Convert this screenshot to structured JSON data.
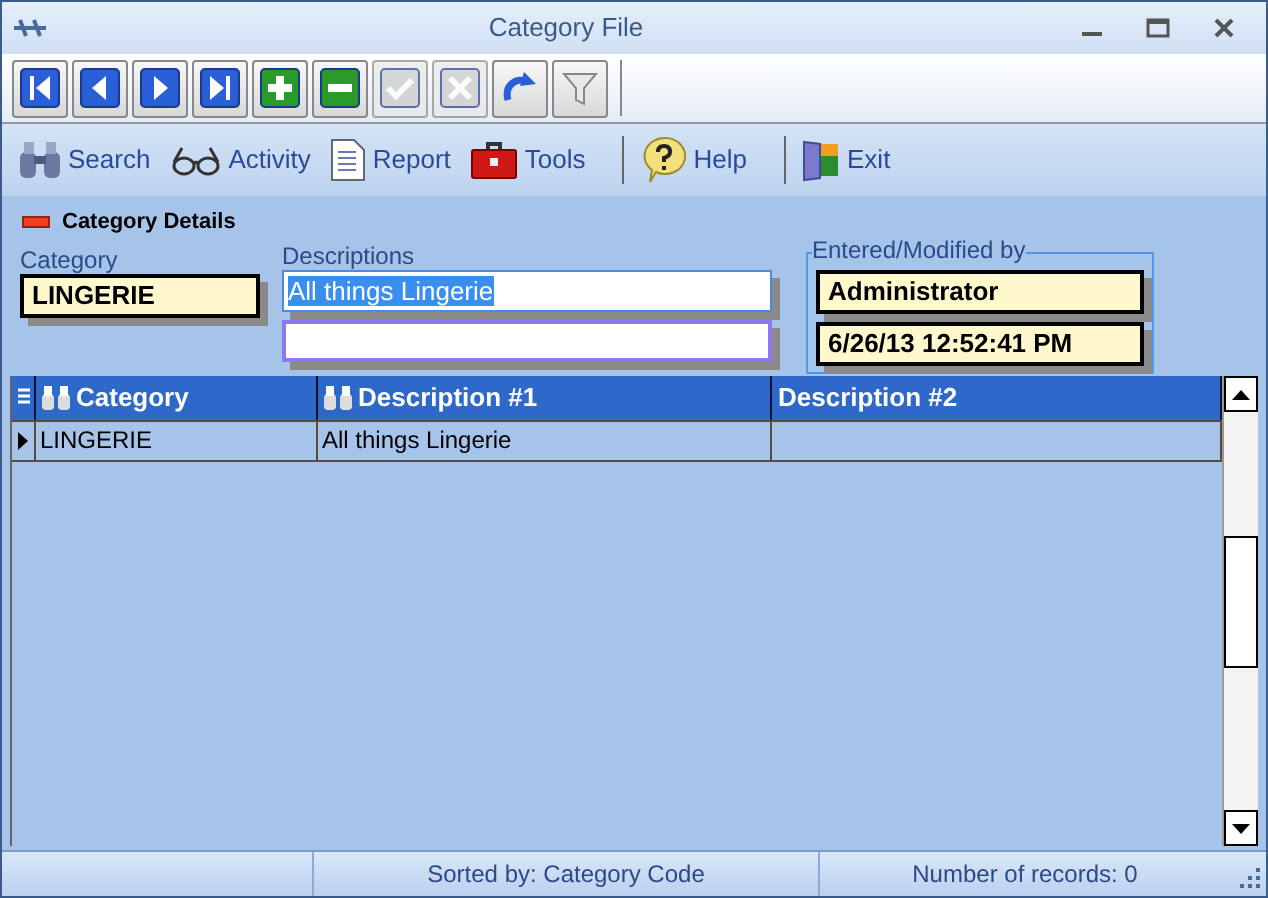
{
  "window": {
    "title": "Category File"
  },
  "toolbar": [
    {
      "kind": "first",
      "disabled": false
    },
    {
      "kind": "previous",
      "disabled": false
    },
    {
      "kind": "next",
      "disabled": false
    },
    {
      "kind": "last",
      "disabled": false
    },
    {
      "kind": "add",
      "disabled": false
    },
    {
      "kind": "delete",
      "disabled": false
    },
    {
      "kind": "save",
      "disabled": true
    },
    {
      "kind": "cancel",
      "disabled": true
    },
    {
      "kind": "redo",
      "disabled": false
    },
    {
      "kind": "filter",
      "disabled": false
    }
  ],
  "menu": [
    {
      "kind": "search",
      "label": "Search"
    },
    {
      "kind": "activity",
      "label": "Activity"
    },
    {
      "kind": "report",
      "label": "Report"
    },
    {
      "kind": "tools",
      "label": "Tools"
    },
    {
      "kind": "help",
      "label": "Help"
    },
    {
      "kind": "exit",
      "label": "Exit"
    }
  ],
  "section_title": "Category Details",
  "form": {
    "category_label": "Category",
    "category_value": "LINGERIE",
    "descriptions_label": "Descriptions",
    "description_1": "All things Lingerie",
    "description_1_selected": true,
    "audit_label": "Entered/Modified by",
    "modified_by": "Administrator",
    "modified_at": "6/26/13 12:52:41 PM"
  },
  "table": {
    "columns": [
      {
        "label": "Category",
        "sortable": true
      },
      {
        "label": "Description #1",
        "sortable": true
      },
      {
        "label": "Description #2",
        "sortable": false
      }
    ],
    "rows": [
      {
        "cells": [
          "LINGERIE",
          "All things Lingerie",
          ""
        ],
        "current": true
      }
    ]
  },
  "status_bar": {
    "sorted_by": "Sorted by: Category Code",
    "record_count": "Number of records: 0"
  }
}
